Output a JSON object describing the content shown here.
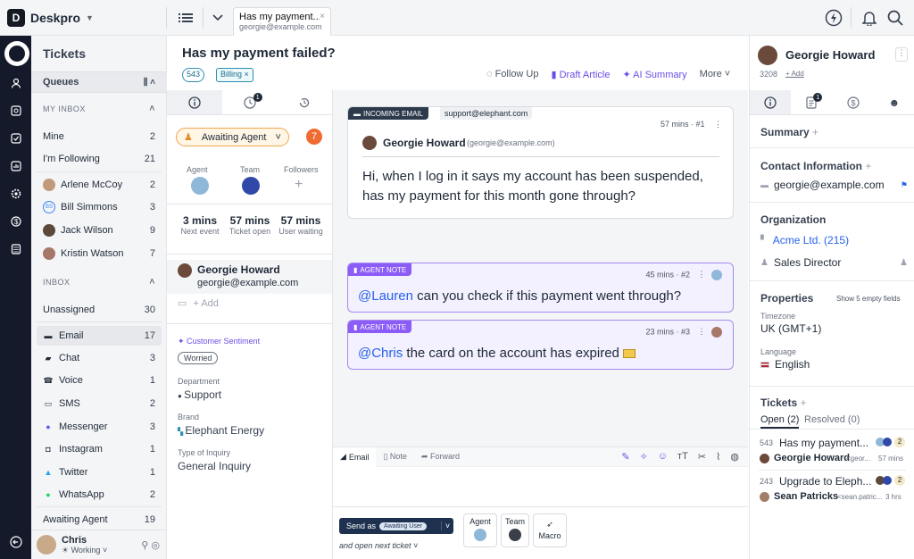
{
  "app": {
    "name": "Deskpro"
  },
  "tab": {
    "title": "Has my payment...",
    "subtitle": "georgie@example.com"
  },
  "sidebar": {
    "title": "Tickets",
    "queues_label": "Queues",
    "my_inbox_label": "MY INBOX",
    "my_inbox": [
      {
        "label": "Mine",
        "count": "2"
      },
      {
        "label": "I'm Following",
        "count": "21"
      },
      {
        "label": "Arlene McCoy",
        "count": "2"
      },
      {
        "label": "Bill Simmons",
        "count": "3",
        "initials": "BS"
      },
      {
        "label": "Jack Wilson",
        "count": "9"
      },
      {
        "label": "Kristin Watson",
        "count": "7"
      }
    ],
    "inbox_label": "INBOX",
    "inbox": [
      {
        "label": "Unassigned",
        "count": "30"
      },
      {
        "label": "Email",
        "count": "17",
        "icon": "email-icon"
      },
      {
        "label": "Chat",
        "count": "3",
        "icon": "chat-icon"
      },
      {
        "label": "Voice",
        "count": "1",
        "icon": "phone-icon"
      },
      {
        "label": "SMS",
        "count": "2",
        "icon": "sms-icon"
      },
      {
        "label": "Messenger",
        "count": "3",
        "icon": "messenger-icon"
      },
      {
        "label": "Instagram",
        "count": "1",
        "icon": "instagram-icon"
      },
      {
        "label": "Twitter",
        "count": "1",
        "icon": "twitter-icon"
      },
      {
        "label": "WhatsApp",
        "count": "2",
        "icon": "whatsapp-icon"
      },
      {
        "label": "Awaiting Agent",
        "count": "19"
      }
    ],
    "user": {
      "name": "Chris",
      "status": "Working"
    }
  },
  "ticket": {
    "title": "Has my payment failed?",
    "id": "543",
    "label": "Billing",
    "actions": [
      "Follow Up",
      "Draft Article",
      "AI Summary",
      "More"
    ]
  },
  "properties": {
    "status": "Awaiting Agent",
    "urgency": "7",
    "agent_label": "Agent",
    "team_label": "Team",
    "followers_label": "Followers",
    "times": [
      {
        "value": "3 mins",
        "label": "Next event"
      },
      {
        "value": "57 mins",
        "label": "Ticket open"
      },
      {
        "value": "57 mins",
        "label": "User waiting"
      }
    ],
    "history_badge": "1",
    "person_name": "Georgie Howard",
    "person_email": "georgie@example.com",
    "add": "+ Add",
    "sentiment_label": "Customer Sentiment",
    "sentiment": "Worried",
    "department_label": "Department",
    "department": "Support",
    "brand_label": "Brand",
    "brand": "Elephant Energy",
    "type_label": "Type of Inquiry",
    "type": "General Inquiry"
  },
  "messages": [
    {
      "badge": "INCOMING EMAIL",
      "address": "support@elephant.com",
      "time": "57 mins",
      "num": "#1",
      "author": "Georgie Howard",
      "author_email": "(georgie@example.com)",
      "text": "Hi, when I log in it says my account has been suspended, has my payment for this month gone through?"
    },
    {
      "badge": "AGENT NOTE",
      "time": "45 mins",
      "num": "#2",
      "mention": "@Lauren",
      "text": " can you check if this payment went through?"
    },
    {
      "badge": "AGENT NOTE",
      "time": "23 mins",
      "num": "#3",
      "mention": "@Chris",
      "text": " the card on the account has expired"
    }
  ],
  "compose": {
    "tabs": [
      "Email",
      "Note",
      "Forward"
    ],
    "send_label": "Send as",
    "send_status": "Awaiting User",
    "next": "and open next ticket",
    "agent": "Agent",
    "team": "Team",
    "macro": "Macro"
  },
  "right": {
    "name": "Georgie Howard",
    "id": "3208",
    "add": "+ Add",
    "summary": "Summary",
    "contact_info": "Contact Information",
    "email": "georgie@example.com",
    "organization": "Organization",
    "org_name": "Acme Ltd. (215)",
    "role": "Sales Director",
    "properties": "Properties",
    "show_empty": "Show 5 empty fields",
    "timezone_label": "Timezone",
    "timezone": "UK (GMT+1)",
    "language_label": "Language",
    "language": "English",
    "tickets": "Tickets",
    "open_tab": "Open (2)",
    "resolved_tab": "Resolved (0)",
    "tab_badge": "1",
    "ticket_list": [
      {
        "id": "543",
        "title": "Has my payment...",
        "count": "2",
        "person": "Georgie Howard",
        "email": "<geor...",
        "time": "57 mins"
      },
      {
        "id": "243",
        "title": "Upgrade to Eleph...",
        "count": "2",
        "person": "Sean Patricks",
        "email": "<sean.patric...",
        "time": "3 hrs"
      }
    ]
  },
  "colors": {
    "accent": "#8b5cf6",
    "rail": "#141a2a",
    "link": "#2563eb"
  }
}
